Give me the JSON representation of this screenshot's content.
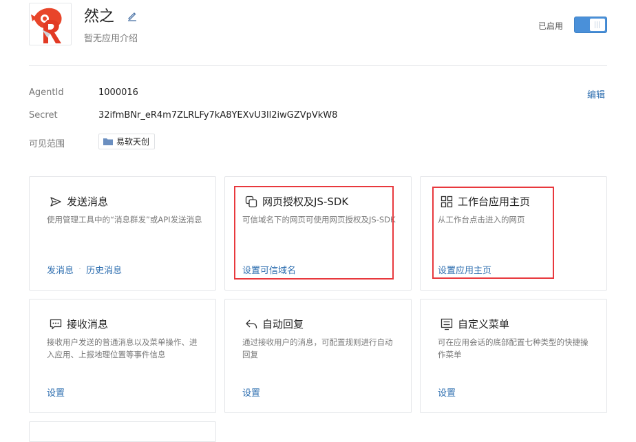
{
  "app": {
    "name": "然之",
    "description": "暂无应用介绍",
    "status_label": "已启用",
    "enabled": true
  },
  "info": {
    "agentid_label": "AgentId",
    "agentid_value": "1000016",
    "secret_label": "Secret",
    "secret_value": "32ifmBNr_eR4m7ZLRLFy7kA8YEXvU3ll2iwGZVpVkW8",
    "scope_label": "可见范围",
    "scope_value": "易软天创",
    "edit_label": "编辑"
  },
  "cards": [
    {
      "icon": "send-icon",
      "title": "发送消息",
      "desc": "使用管理工具中的“消息群发”或API发送消息",
      "links": [
        "发消息",
        "历史消息"
      ]
    },
    {
      "icon": "web-auth-icon",
      "title": "网页授权及JS-SDK",
      "desc": "可信域名下的网页可使用网页授权及JS-SDK",
      "links": [
        "设置可信域名"
      ]
    },
    {
      "icon": "grid-icon",
      "title": "工作台应用主页",
      "desc": "从工作台点击进入的网页",
      "links": [
        "设置应用主页"
      ]
    },
    {
      "icon": "message-icon",
      "title": "接收消息",
      "desc": "接收用户发送的普通消息以及菜单操作、进入应用、上报地理位置等事件信息",
      "links": [
        "设置"
      ]
    },
    {
      "icon": "reply-icon",
      "title": "自动回复",
      "desc": "通过接收用户的消息，可配置规则进行自动回复",
      "links": [
        "设置"
      ]
    },
    {
      "icon": "menu-icon",
      "title": "自定义菜单",
      "desc": "可在应用会话的底部配置七种类型的快捷操作菜单",
      "links": [
        "设置"
      ]
    }
  ],
  "colors": {
    "accent": "#2f6fb0",
    "toggle_on": "#4a90d9",
    "highlight": "#e8383d"
  }
}
